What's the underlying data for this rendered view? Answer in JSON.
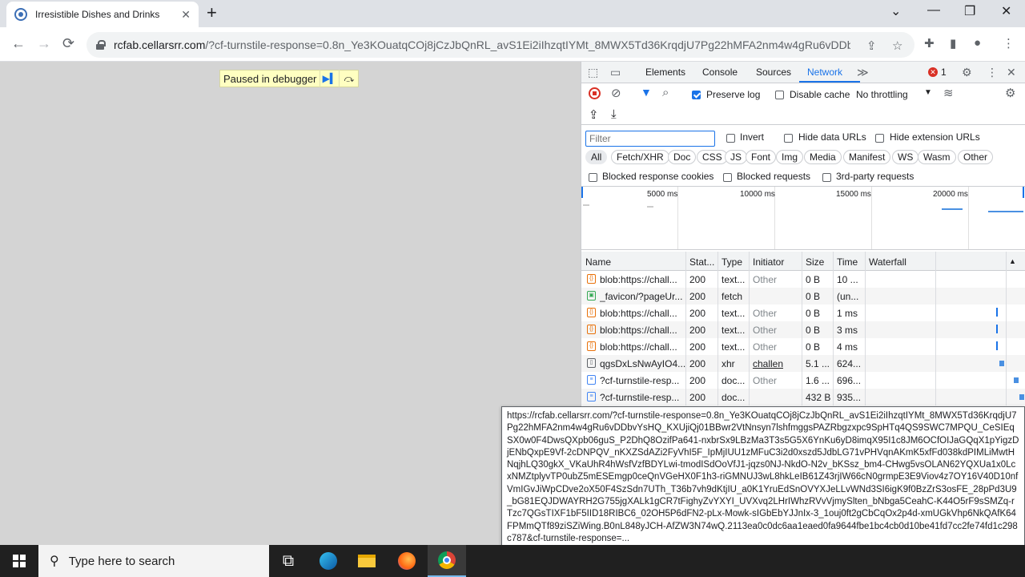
{
  "browser": {
    "tab_title": "Irresistible Dishes and Drinks",
    "tab_close": "✕",
    "new_tab": "+",
    "window_controls": {
      "minimize": "—",
      "maximize": "❐",
      "close": "✕",
      "tab_search": "⌄"
    },
    "url_host": "rcfab.cellarsrr.com",
    "url_rest": "/?cf-turnstile-response=0.8n_Ye3KOuatqCOj8jCzJbQnRL_avS1Ei2iIhzqtIYMt_8MWX5Td36KrqdjU7Pg22hMFA2nm4w4gRu6vDDbvYs..."
  },
  "page": {
    "debugger_label": "Paused in debugger"
  },
  "devtools": {
    "tabs": [
      "Elements",
      "Console",
      "Sources",
      "Network"
    ],
    "active_tab": "Network",
    "more_tabs": "≫",
    "error_count": "1",
    "toolbar": {
      "preserve_log": "Preserve log",
      "disable_cache": "Disable cache",
      "throttling": "No throttling"
    },
    "filter_placeholder": "Filter",
    "filter_options": {
      "invert": "Invert",
      "hide_data_urls": "Hide data URLs",
      "hide_extension_urls": "Hide extension URLs"
    },
    "type_chips": [
      "All",
      "Fetch/XHR",
      "Doc",
      "CSS",
      "JS",
      "Font",
      "Img",
      "Media",
      "Manifest",
      "WS",
      "Wasm",
      "Other"
    ],
    "blocked_options": {
      "blocked_response_cookies": "Blocked response cookies",
      "blocked_requests": "Blocked requests",
      "third_party": "3rd-party requests"
    },
    "overview_ticks": [
      "5000 ms",
      "10000 ms",
      "15000 ms",
      "20000 ms"
    ],
    "columns": {
      "name": "Name",
      "status": "Stat...",
      "type": "Type",
      "initiator": "Initiator",
      "size": "Size",
      "time": "Time",
      "waterfall": "Waterfall"
    },
    "requests": [
      {
        "icon": "script",
        "name": "blob:https://chall...",
        "status": "200",
        "type": "text...",
        "initiator": "Other",
        "size": "0 B",
        "time": "10 ..."
      },
      {
        "icon": "image",
        "name": "_favicon/?pageUr...",
        "status": "200",
        "type": "fetch",
        "initiator": "",
        "size": "0 B",
        "time": "(un..."
      },
      {
        "icon": "script",
        "name": "blob:https://chall...",
        "status": "200",
        "type": "text...",
        "initiator": "Other",
        "size": "0 B",
        "time": "1 ms"
      },
      {
        "icon": "script",
        "name": "blob:https://chall...",
        "status": "200",
        "type": "text...",
        "initiator": "Other",
        "size": "0 B",
        "time": "3 ms"
      },
      {
        "icon": "script",
        "name": "blob:https://chall...",
        "status": "200",
        "type": "text...",
        "initiator": "Other",
        "size": "0 B",
        "time": "4 ms"
      },
      {
        "icon": "plain",
        "name": "qgsDxLsNwAyIO4...",
        "status": "200",
        "type": "xhr",
        "initiator": "challeng...",
        "size": "5.1 ...",
        "time": "624..."
      },
      {
        "icon": "doc",
        "name": "?cf-turnstile-resp...",
        "status": "200",
        "type": "doc...",
        "initiator": "Other",
        "size": "1.6 ...",
        "time": "696..."
      },
      {
        "icon": "doc",
        "name": "?cf-turnstile-resp...",
        "status": "200",
        "type": "doc...",
        "initiator": "",
        "size": "432 B",
        "time": "935..."
      }
    ],
    "tooltip": "https://rcfab.cellarsrr.com/?cf-turnstile-response=0.8n_Ye3KOuatqCOj8jCzJbQnRL_avS1Ei2iIhzqtIYMt_8MWX5Td36KrqdjU7Pg22hMFA2nm4w4gRu6vDDbvYsHQ_KXUjiQj01BBwr2VtNnsyn7lshfmggsPAZRbgzxpc9SpHTq4QS9SWC7MPQU_CeSIEqSX0w0F4DwsQXpb06guS_P2DhQ8OzifPa641-nxbrSx9LBzMa3T3s5G5X6YnKu6yD8imqX95I1c8JM6OCfOIJaGQqX1pYigzDjENbQxpE9Vf-2cDNPQV_nKXZSdAZi2FyVhI5F_IpMjIUU1zMFuC3i2d0xszd5JdbLG71vPHVqnAKmK5xfFd038kdPIMLiMwtHNqjhLQ30gkX_VKaUhR4hWsfVzfBDYLwi-tmodISdOoVfJ1-jqzs0NJ-NkdO-N2v_bKSsz_bm4-CHwg5vsOLAN62YQXUa1x0LcxNMZtplyvTP0ubZ5mESEmgp0ceQnVGeHX0F1h3-riGMNUJ3wL8hkLeIB61Z43rjIW66cN0grmpE3E9Viov4z7OY16V40D10nfVmIGvJiWpCDve2oX50F4SzSdn7UTh_T36b7vh9dKtjIU_a0K1YruEdSnOVYXJeLLvWNd3SI6igK9f0BzZrS3osFE_28pPd3U9_bG81EQJDWAYRH2G755jgXALk1gCR7tFighyZvYXYI_UVXvq2LHrIWhzRVvVjmySlten_bNbga5CeahC-K44O5rF9sSMZq-rTzc7QGsTIXF1bF5IID18RIBC6_02OH5P6dFN2-pLx-Mowk-sIGbEbYJJnIx-3_1ouj0ft2gCbCqOx2p4d-xmUGkVhp6NkQAfK64FPMmQTf89ziSZiWing.B0nL848yJCH-AfZW3N74wQ.2113ea0c0dc6aa1eaed0fa9644fbe1bc4cb0d10be41fd7cc2fe74fd1c298c787&cf-turnstile-response=..."
  },
  "taskbar": {
    "search_placeholder": "Type here to search"
  }
}
